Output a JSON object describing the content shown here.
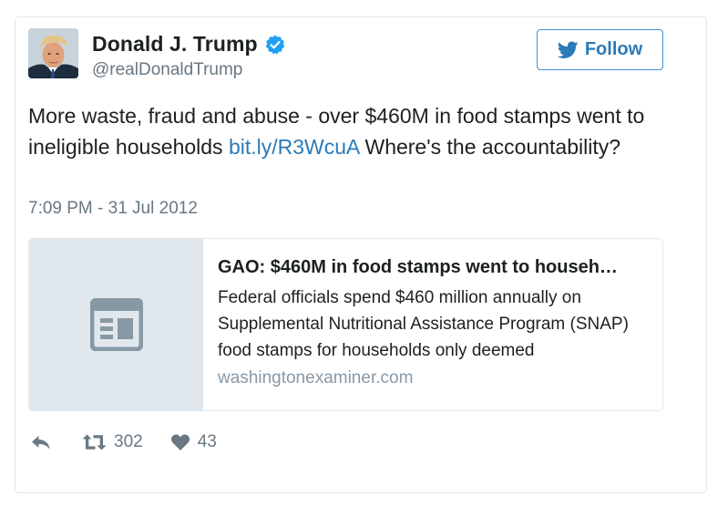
{
  "tweet": {
    "author_name": "Donald J. Trump",
    "author_handle": "@realDonaldTrump",
    "follow_label": "Follow",
    "text_before_link": "More waste, fraud and abuse - over $460M in food stamps went to ineligible households ",
    "link_text": "bit.ly/R3WcuA",
    "text_after_link": " Where's the accountability?",
    "timestamp": "7:09 PM - 31 Jul 2012",
    "retweet_count": "302",
    "like_count": "43"
  },
  "link_card": {
    "title": "GAO: $460M in food stamps went to househ…",
    "description": "Federal officials spend $460 million annually on Supplemental Nutritional Assistance Program (SNAP) food stamps for households only deemed",
    "domain": "washingtonexaminer.com"
  },
  "colors": {
    "link": "#2b7bb9",
    "verified": "#1da1f2",
    "muted": "#697882",
    "border": "#e1e8ed"
  },
  "icons": [
    "verified-badge-icon",
    "twitter-bird-icon",
    "article-icon",
    "reply-icon",
    "retweet-icon",
    "heart-icon"
  ]
}
